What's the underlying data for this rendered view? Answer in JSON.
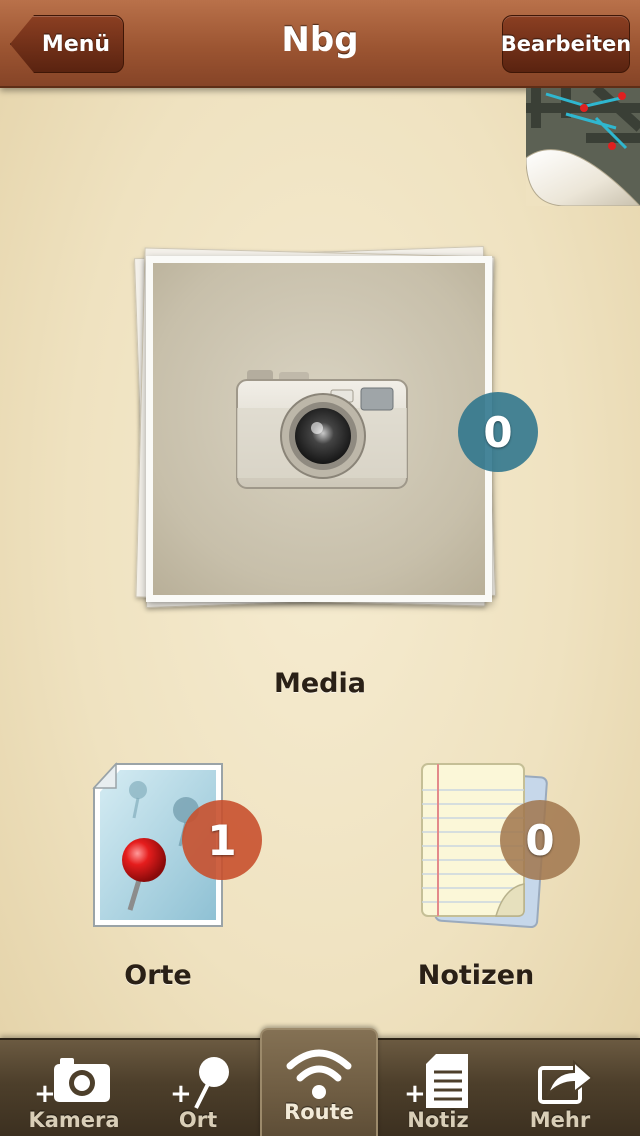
{
  "navbar": {
    "title": "Nbg",
    "back_label": "Menü",
    "edit_label": "Bearbeiten"
  },
  "map_corner": {
    "icon": "map-page-curl-icon"
  },
  "media": {
    "label": "Media",
    "count": "0",
    "icon": "camera-icon"
  },
  "orte": {
    "label": "Orte",
    "count": "1",
    "icon": "map-pin-document-icon"
  },
  "notizen": {
    "label": "Notizen",
    "count": "0",
    "icon": "notepad-icon"
  },
  "toolbar": {
    "items": [
      {
        "label": "Kamera",
        "icon": "add-camera-icon"
      },
      {
        "label": "Ort",
        "icon": "add-pin-icon"
      },
      {
        "label": "Route",
        "icon": "wifi-route-icon",
        "selected": true
      },
      {
        "label": "Notiz",
        "icon": "add-note-icon"
      },
      {
        "label": "Mehr",
        "icon": "share-icon"
      }
    ]
  },
  "colors": {
    "navbar": "#9c5532",
    "badge_media": "#2c748c",
    "badge_orte": "#c8502d",
    "badge_notizen": "#a0764c",
    "toolbar": "#4d3f2b"
  }
}
